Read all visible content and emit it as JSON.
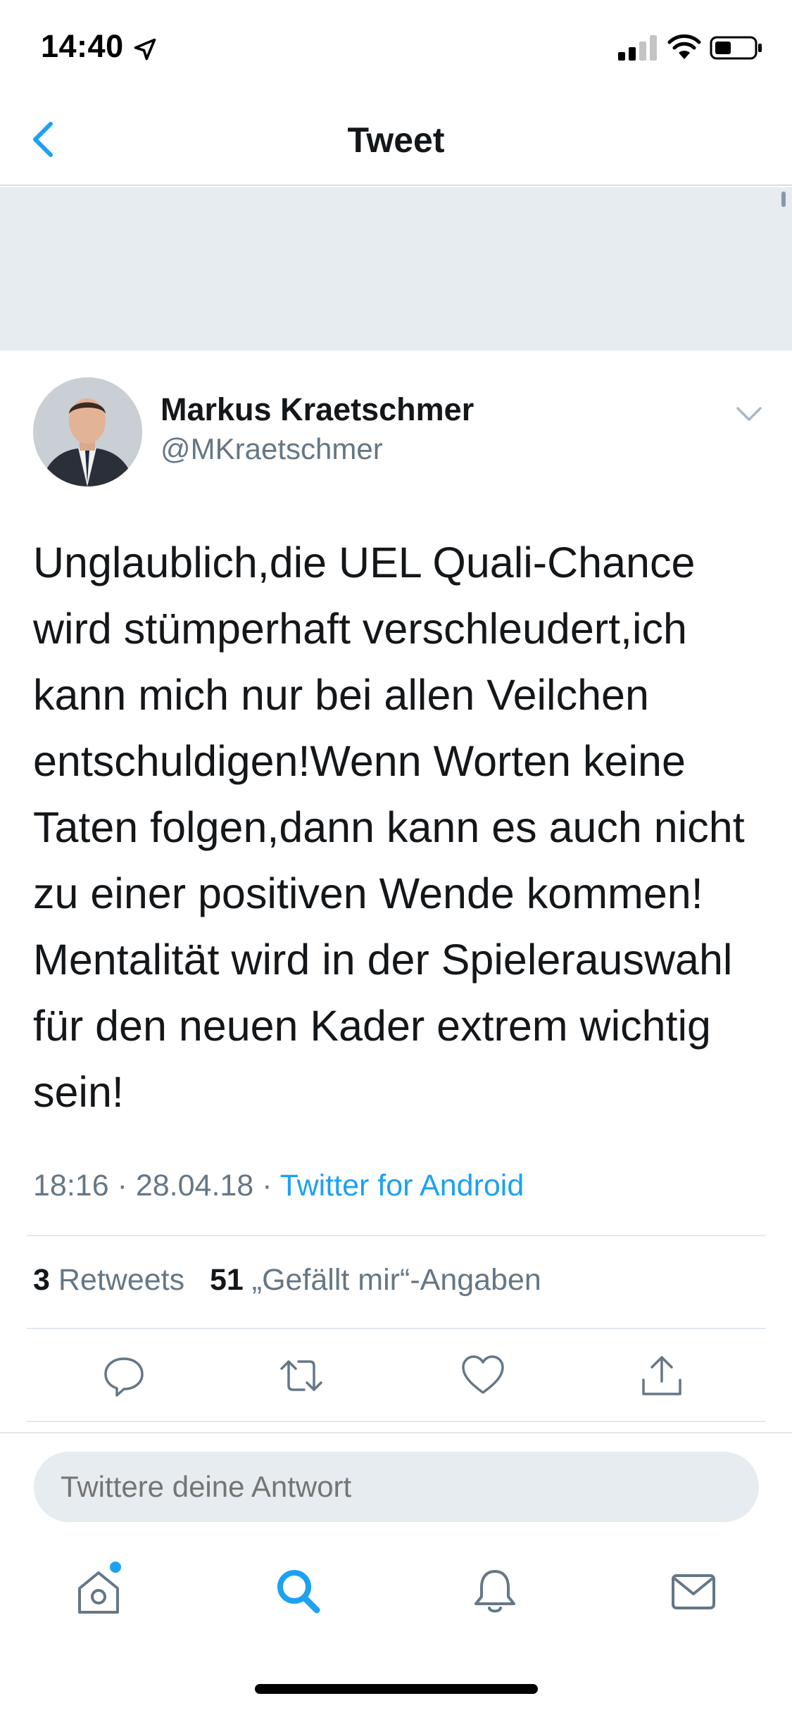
{
  "status_bar": {
    "time": "14:40"
  },
  "nav": {
    "title": "Tweet"
  },
  "tweet": {
    "author_name": "Markus Kraetschmer",
    "author_handle": "@MKraetschmer",
    "text": "Unglaublich,die UEL Quali-Chance\nwird stümperhaft verschleudert,ich\nkann mich nur bei allen Veilchen\nentschuldigen!Wenn Worten keine\nTaten folgen,dann kann es auch nicht\nzu einer positiven Wende kommen!\nMentalität wird in der Spielerauswahl\nfür den neuen Kader extrem wichtig\nsein!",
    "time": "18:16",
    "date": "28.04.18",
    "separator": "·",
    "source": "Twitter for Android",
    "retweet_count": "3",
    "retweet_label": "Retweets",
    "like_count": "51",
    "like_label": "„Gefällt mir“-Angaben"
  },
  "actions": [
    "reply-icon",
    "retweet-icon",
    "like-icon",
    "share-icon"
  ],
  "reply": {
    "placeholder": "Twittere deine Antwort"
  },
  "tab_bar": [
    "home-icon",
    "search-icon",
    "notifications-icon",
    "messages-icon"
  ],
  "colors": {
    "accent": "#1da1f2",
    "secondary_text": "#657786",
    "banner": "#e6ecf0"
  }
}
